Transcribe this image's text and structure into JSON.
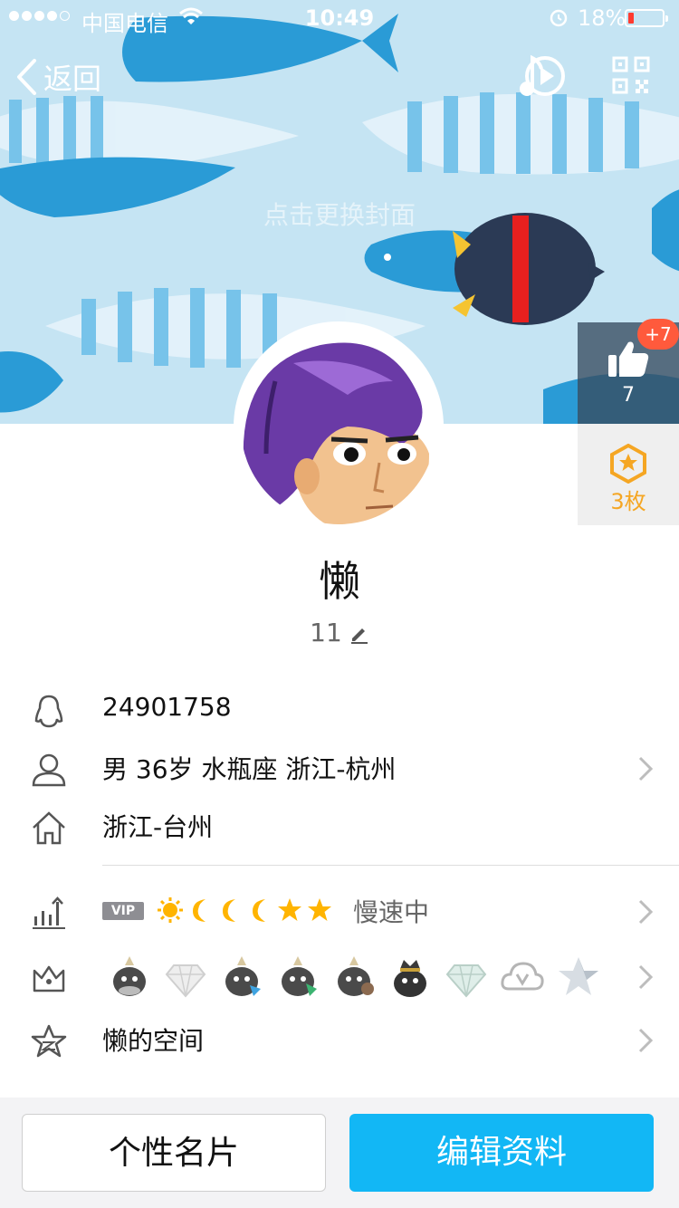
{
  "status_bar": {
    "carrier": "中国电信",
    "time": "10:49",
    "battery": "18%",
    "battery_level": 0.18
  },
  "nav": {
    "back_label": "返回",
    "icons": [
      "back-chevron-icon",
      "music-play-icon",
      "qr-code-icon"
    ]
  },
  "cover": {
    "hint": "点击更换封面",
    "colors": {
      "sea": "#c5e4f3",
      "fish_dark": "#2a9bd6",
      "fish_light": "#e6f3fb"
    }
  },
  "likes": {
    "count": "7",
    "new_badge": "+7"
  },
  "medals": {
    "count": "3枚",
    "color": "#f5a623"
  },
  "profile": {
    "nickname": "懒",
    "level": "11"
  },
  "info": {
    "qq_number": "24901758",
    "basic": "男 36岁 水瓶座 浙江-杭州",
    "hometown": "浙江-台州"
  },
  "vip_row": {
    "vip_label": "VIP",
    "level_icons": [
      "sun-icon",
      "moon-icon",
      "moon-icon",
      "moon-icon",
      "star-icon",
      "star-icon"
    ],
    "accelerate": "慢速中"
  },
  "badges_row": {
    "badges": [
      "penguin-badge",
      "diamond-badge",
      "penguin-badge",
      "penguin-badge",
      "penguin-badge",
      "crown-penguin-badge",
      "diamond-badge",
      "cloud-v-badge",
      "star-badge"
    ]
  },
  "space_row": {
    "label": "懒的空间"
  },
  "buttons": {
    "card": "个性名片",
    "edit": "编辑资料",
    "edit_color": "#12b7f5"
  }
}
